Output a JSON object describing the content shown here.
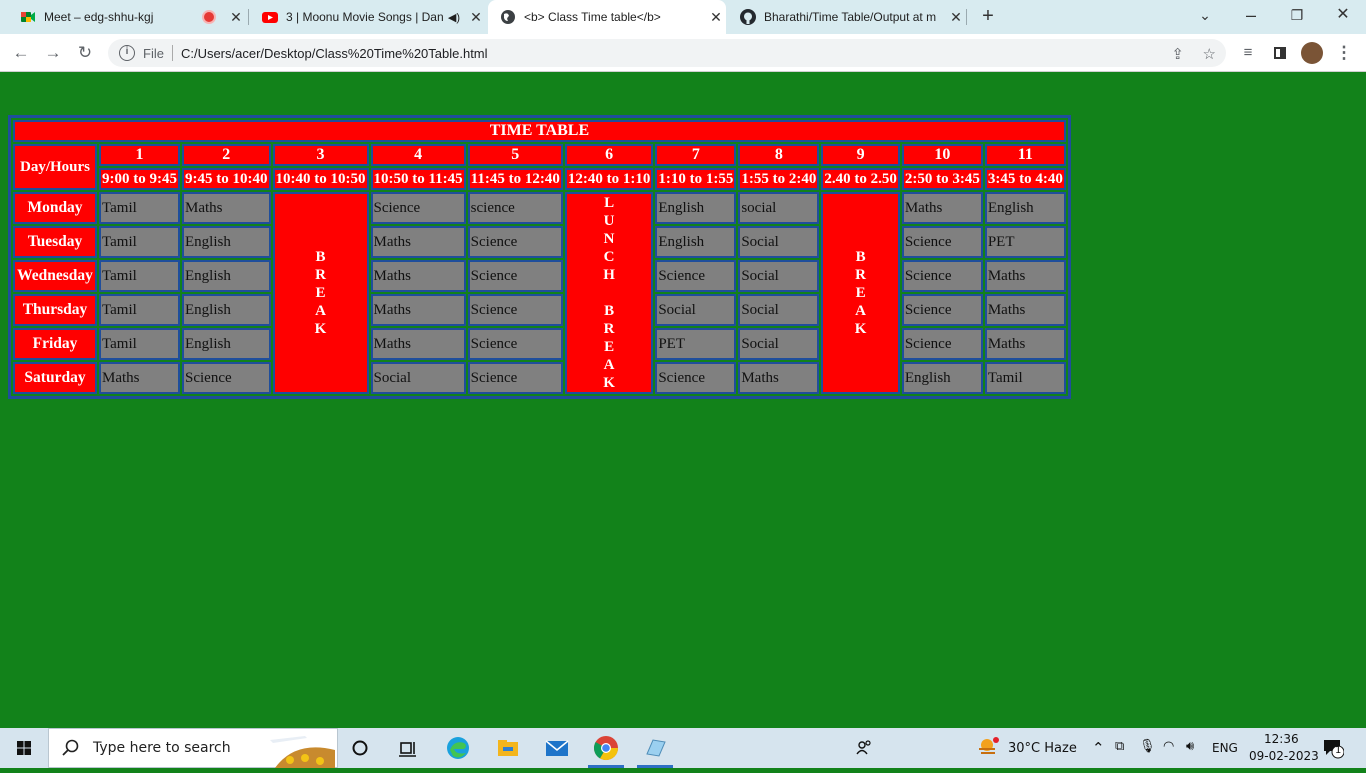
{
  "browser": {
    "tabs": [
      {
        "title": "Meet – edg-shhu-kgj",
        "icon": "meet-icon"
      },
      {
        "title": "3 | Moonu Movie Songs | Dan",
        "icon": "youtube-icon"
      },
      {
        "title": "<b> Class Time table</b>",
        "icon": "globe-icon"
      },
      {
        "title": "Bharathi/Time Table/Output at m",
        "icon": "github-icon"
      }
    ],
    "address": {
      "scheme_label": "File",
      "url": "C:/Users/acer/Desktop/Class%20Time%20Table.html"
    }
  },
  "timetable": {
    "title": "TIME TABLE",
    "corner_header": "Day/Hours",
    "periods": [
      {
        "num": "1",
        "time": "9:00 to 9:45"
      },
      {
        "num": "2",
        "time": "9:45 to 10:40"
      },
      {
        "num": "3",
        "time": "10:40 to 10:50"
      },
      {
        "num": "4",
        "time": "10:50 to 11:45"
      },
      {
        "num": "5",
        "time": "11:45 to 12:40"
      },
      {
        "num": "6",
        "time": "12:40 to 1:10"
      },
      {
        "num": "7",
        "time": "1:10 to 1:55"
      },
      {
        "num": "8",
        "time": "1:55 to 2:40"
      },
      {
        "num": "9",
        "time": "2.40 to 2.50"
      },
      {
        "num": "10",
        "time": "2:50 to 3:45"
      },
      {
        "num": "11",
        "time": "3:45 to 4:40"
      }
    ],
    "break_letters": [
      "B",
      "R",
      "E",
      "A",
      "K"
    ],
    "lunch_letters": [
      "L",
      "U",
      "N",
      "C",
      "H",
      "",
      "B",
      "R",
      "E",
      "A",
      "K"
    ],
    "days": [
      {
        "day": "Monday",
        "p1": "Tamil",
        "p2": "Maths",
        "p4": "Science",
        "p5": "science",
        "p7": "English",
        "p8": "social",
        "p10": "Maths",
        "p11": "English"
      },
      {
        "day": "Tuesday",
        "p1": "Tamil",
        "p2": "English",
        "p4": "Maths",
        "p5": "Science",
        "p7": "English",
        "p8": "Social",
        "p10": "Science",
        "p11": "PET"
      },
      {
        "day": "Wednesday",
        "p1": "Tamil",
        "p2": "English",
        "p4": "Maths",
        "p5": "Science",
        "p7": "Science",
        "p8": "Social",
        "p10": "Science",
        "p11": "Maths"
      },
      {
        "day": "Thursday",
        "p1": "Tamil",
        "p2": "English",
        "p4": "Maths",
        "p5": "Science",
        "p7": "Social",
        "p8": "Social",
        "p10": "Science",
        "p11": "Maths"
      },
      {
        "day": "Friday",
        "p1": "Tamil",
        "p2": "English",
        "p4": "Maths",
        "p5": "Science",
        "p7": "PET",
        "p8": "Social",
        "p10": "Science",
        "p11": "Maths"
      },
      {
        "day": "Saturday",
        "p1": "Maths",
        "p2": "Science",
        "p4": "Social",
        "p5": "Science",
        "p7": "Science",
        "p8": "Maths",
        "p10": "English",
        "p11": "Tamil"
      }
    ]
  },
  "taskbar": {
    "search_placeholder": "Type here to search",
    "weather": "30°C  Haze",
    "language": "ENG",
    "time": "12:36",
    "date": "09-02-2023",
    "notification_count": "1"
  },
  "colors": {
    "page_bg": "#12821a",
    "header_red": "#ff0000",
    "cell_grey": "#808080",
    "border_blue": "#1f4e9c"
  }
}
